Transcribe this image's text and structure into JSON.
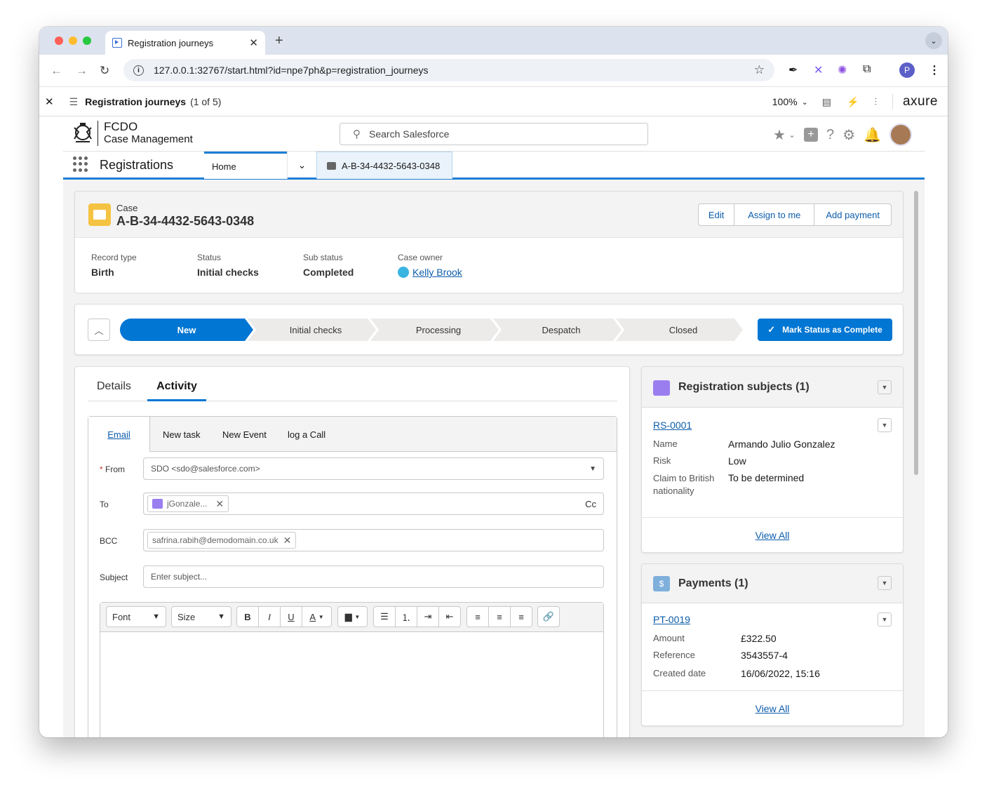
{
  "browser": {
    "tab_title": "Registration journeys",
    "url": "127.0.0.1:32767/start.html?id=npe7ph&p=registration_journeys",
    "profile_initial": "P"
  },
  "axure": {
    "page_title": "Registration journeys",
    "page_count": "(1 of 5)",
    "zoom": "100%",
    "brand": "axure"
  },
  "header": {
    "org": "FCDO",
    "product": "Case Management",
    "search_placeholder": "Search Salesforce"
  },
  "appnav": {
    "app_name": "Registrations",
    "home_tab": "Home",
    "record_tab": "A-B-34-4432-5643-0348"
  },
  "record": {
    "object": "Case",
    "number": "A-B-34-4432-5643-0348",
    "actions": [
      "Edit",
      "Assign to me",
      "Add payment"
    ],
    "fields": [
      {
        "label": "Record type",
        "value": "Birth"
      },
      {
        "label": "Status",
        "value": "Initial checks"
      },
      {
        "label": "Sub status",
        "value": "Completed"
      }
    ],
    "owner_label": "Case owner",
    "owner": "Kelly Brook"
  },
  "path": {
    "steps": [
      "New",
      "Initial checks",
      "Processing",
      "Despatch",
      "Closed"
    ],
    "current": 0,
    "complete_button": "Mark Status as Complete"
  },
  "tabs": {
    "details": "Details",
    "activity": "Activity"
  },
  "composer": {
    "tabs": [
      "Email",
      "New task",
      "New Event",
      "log a Call"
    ],
    "from_label": "From",
    "from_value": "SDO <sdo@salesforce.com>",
    "to_label": "To",
    "to_pill": "jGonzale...",
    "cc": "Cc",
    "bcc_label": "BCC",
    "bcc_pill": "safrina.rabih@demodomain.co.uk",
    "subject_label": "Subject",
    "subject_placeholder": "Enter subject...",
    "font": "Font",
    "size": "Size"
  },
  "subjects": {
    "title": "Registration subjects (1)",
    "record": "RS-0001",
    "rows": [
      {
        "k": "Name",
        "v": "Armando Julio Gonzalez"
      },
      {
        "k": "Risk",
        "v": "Low"
      },
      {
        "k": "Claim to British nationality",
        "v": "To be determined"
      }
    ],
    "view_all": "View All"
  },
  "payments": {
    "title": "Payments (1)",
    "record": "PT-0019",
    "rows": [
      {
        "k": "Amount",
        "v": "£322.50"
      },
      {
        "k": "Reference",
        "v": "3543557-4"
      },
      {
        "k": "Created date",
        "v": "16/06/2022, 15:16"
      }
    ],
    "view_all": "View All"
  },
  "colors": {
    "brand_blue": "#0176d3",
    "link": "#0b5cab",
    "case_icon": "#f5c342",
    "subjects_icon": "#9a7ef0",
    "payments_icon": "#7fb0dc"
  }
}
